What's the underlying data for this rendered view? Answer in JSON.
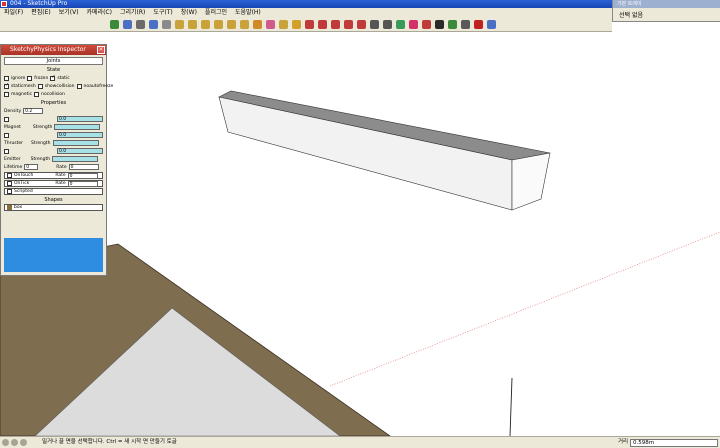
{
  "window": {
    "title": "004 - SketchUp Pro"
  },
  "menu": [
    "파일(F)",
    "편집(E)",
    "보기(V)",
    "카메라(C)",
    "그리기(R)",
    "도구(T)",
    "창(W)",
    "플러그인",
    "도움말(H)"
  ],
  "toolbar_icons": [
    "orbit-icon",
    "pan-icon",
    "zoom-icon",
    "zoom-extents-icon",
    "prev-view-icon",
    "iso-view-icon",
    "top-view-icon",
    "front-view-icon",
    "right-view-icon",
    "back-view-icon",
    "left-view-icon",
    "paint-bucket-icon",
    "eraser-icon",
    "move-icon",
    "rotate-icon",
    "line-icon",
    "arc-icon",
    "circle-icon",
    "rectangle-icon",
    "polygon-icon",
    "push-pull-icon",
    "offset-icon",
    "follow-me-icon",
    "scale-icon",
    "tape-icon",
    "protractor-icon",
    "text-icon",
    "axes-icon",
    "record-icon",
    "play-icon"
  ],
  "right_panel": {
    "title": "기본 트레이",
    "label": "선택 없음"
  },
  "plugin": {
    "title": "SketchyPhysics Inspector",
    "joints_label": "Joints",
    "state_header": "State",
    "state_row1": [
      {
        "label": "ignore",
        "checked": false
      },
      {
        "label": "frozen",
        "checked": false
      },
      {
        "label": "static",
        "checked": true
      }
    ],
    "state_row2": [
      {
        "label": "staticmesh",
        "checked": true
      },
      {
        "label": "showcollision",
        "checked": false
      },
      {
        "label": "noautofreeze",
        "checked": false
      }
    ],
    "state_row3": [
      {
        "label": "magnetic",
        "checked": false
      },
      {
        "label": "nocollision",
        "checked": false
      }
    ],
    "properties_header": "Properties",
    "density_label": "Density",
    "density_value": "0.2",
    "magnet_label": "Magnet",
    "magnet_strength_label": "Strength",
    "magnet_strength_value": "0.0",
    "thruster_label": "Thruster",
    "thruster_strength_label": "Strength",
    "thruster_strength_value": "0.0",
    "emitter_label": "Emitter",
    "emitter_strength_label": "Strength",
    "emitter_strength_value": "0.0",
    "lifetime_label": "Lifetime",
    "lifetime_value": "0",
    "emitter_rate_label": "Rate",
    "emitter_rate_value": "0",
    "ontouch_label": "OnTouch",
    "ontouch_rate_label": "Rate",
    "ontouch_rate_value": "0",
    "ontick_label": "OnTick",
    "ontick_rate_label": "Rate",
    "ontick_rate_value": "0",
    "scripted_label": "Scripted",
    "shapes_header": "Shapes",
    "shape_value": "box"
  },
  "statusbar": {
    "help_text": "밀거나 끌 면을 선택합니다.   Ctrl = 새 시작 면 만들기 토글",
    "distance_label": "거리",
    "distance_value": "0.598m"
  },
  "colors": {
    "floor_brown": "#7f6d50",
    "floor_gray": "#dcdcdc",
    "accent_blue": "#2e8de0"
  }
}
